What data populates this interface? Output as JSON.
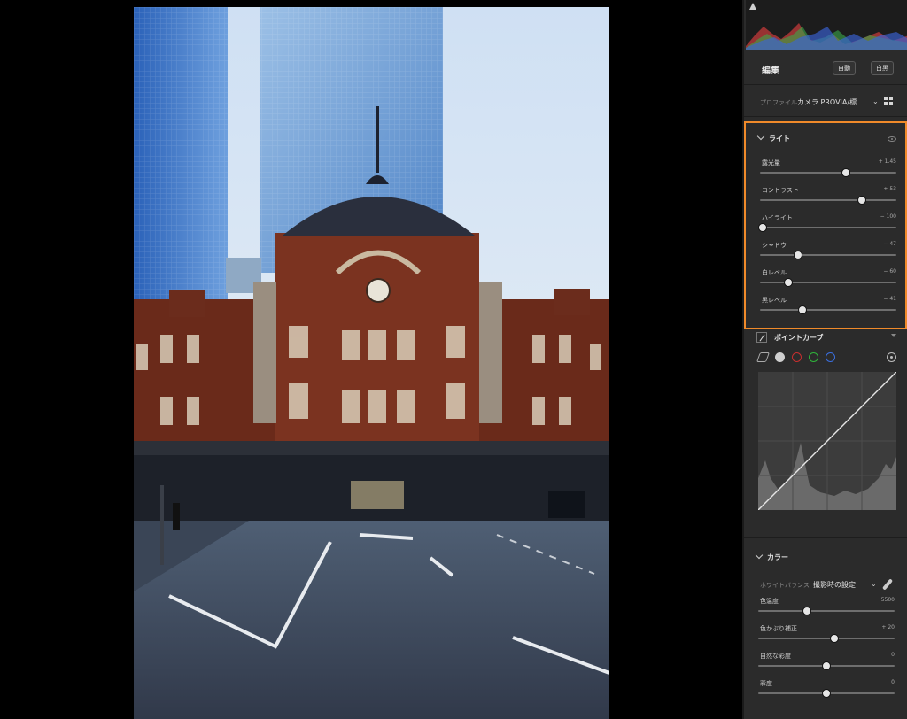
{
  "panel": {
    "edit_title": "編集",
    "auto_label": "自動",
    "bw_label": "白黒",
    "profile": {
      "label": "プロファイル",
      "value": "カメラ PROVIA/標…"
    }
  },
  "light": {
    "title": "ライト",
    "sliders": [
      {
        "label": "露光量",
        "value": "+ 1.45",
        "pos": 0.63
      },
      {
        "label": "コントラスト",
        "value": "+ 53",
        "pos": 0.745
      },
      {
        "label": "ハイライト",
        "value": "− 100",
        "pos": 0.02
      },
      {
        "label": "シャドウ",
        "value": "− 47",
        "pos": 0.28
      },
      {
        "label": "白レベル",
        "value": "− 60",
        "pos": 0.21
      },
      {
        "label": "黒レベル",
        "value": "− 41",
        "pos": 0.31
      }
    ]
  },
  "curve": {
    "title": "ポイントカーブ",
    "channels": [
      "#cfcfcf",
      "#c62f2f",
      "#2fb33a",
      "#3a6fe0"
    ]
  },
  "color": {
    "title": "カラー",
    "wb_label": "ホワイトバランス",
    "wb_value": "撮影時の設定",
    "sliders": [
      {
        "label": "色温度",
        "value": "5500",
        "pos": 0.36,
        "track": "grad"
      },
      {
        "label": "色かぶり補正",
        "value": "+ 20",
        "pos": 0.56,
        "track": "tint"
      },
      {
        "label": "自然な彩度",
        "value": "0",
        "pos": 0.5,
        "track": "vib"
      },
      {
        "label": "彩度",
        "value": "0",
        "pos": 0.5,
        "track": "sat"
      }
    ]
  }
}
